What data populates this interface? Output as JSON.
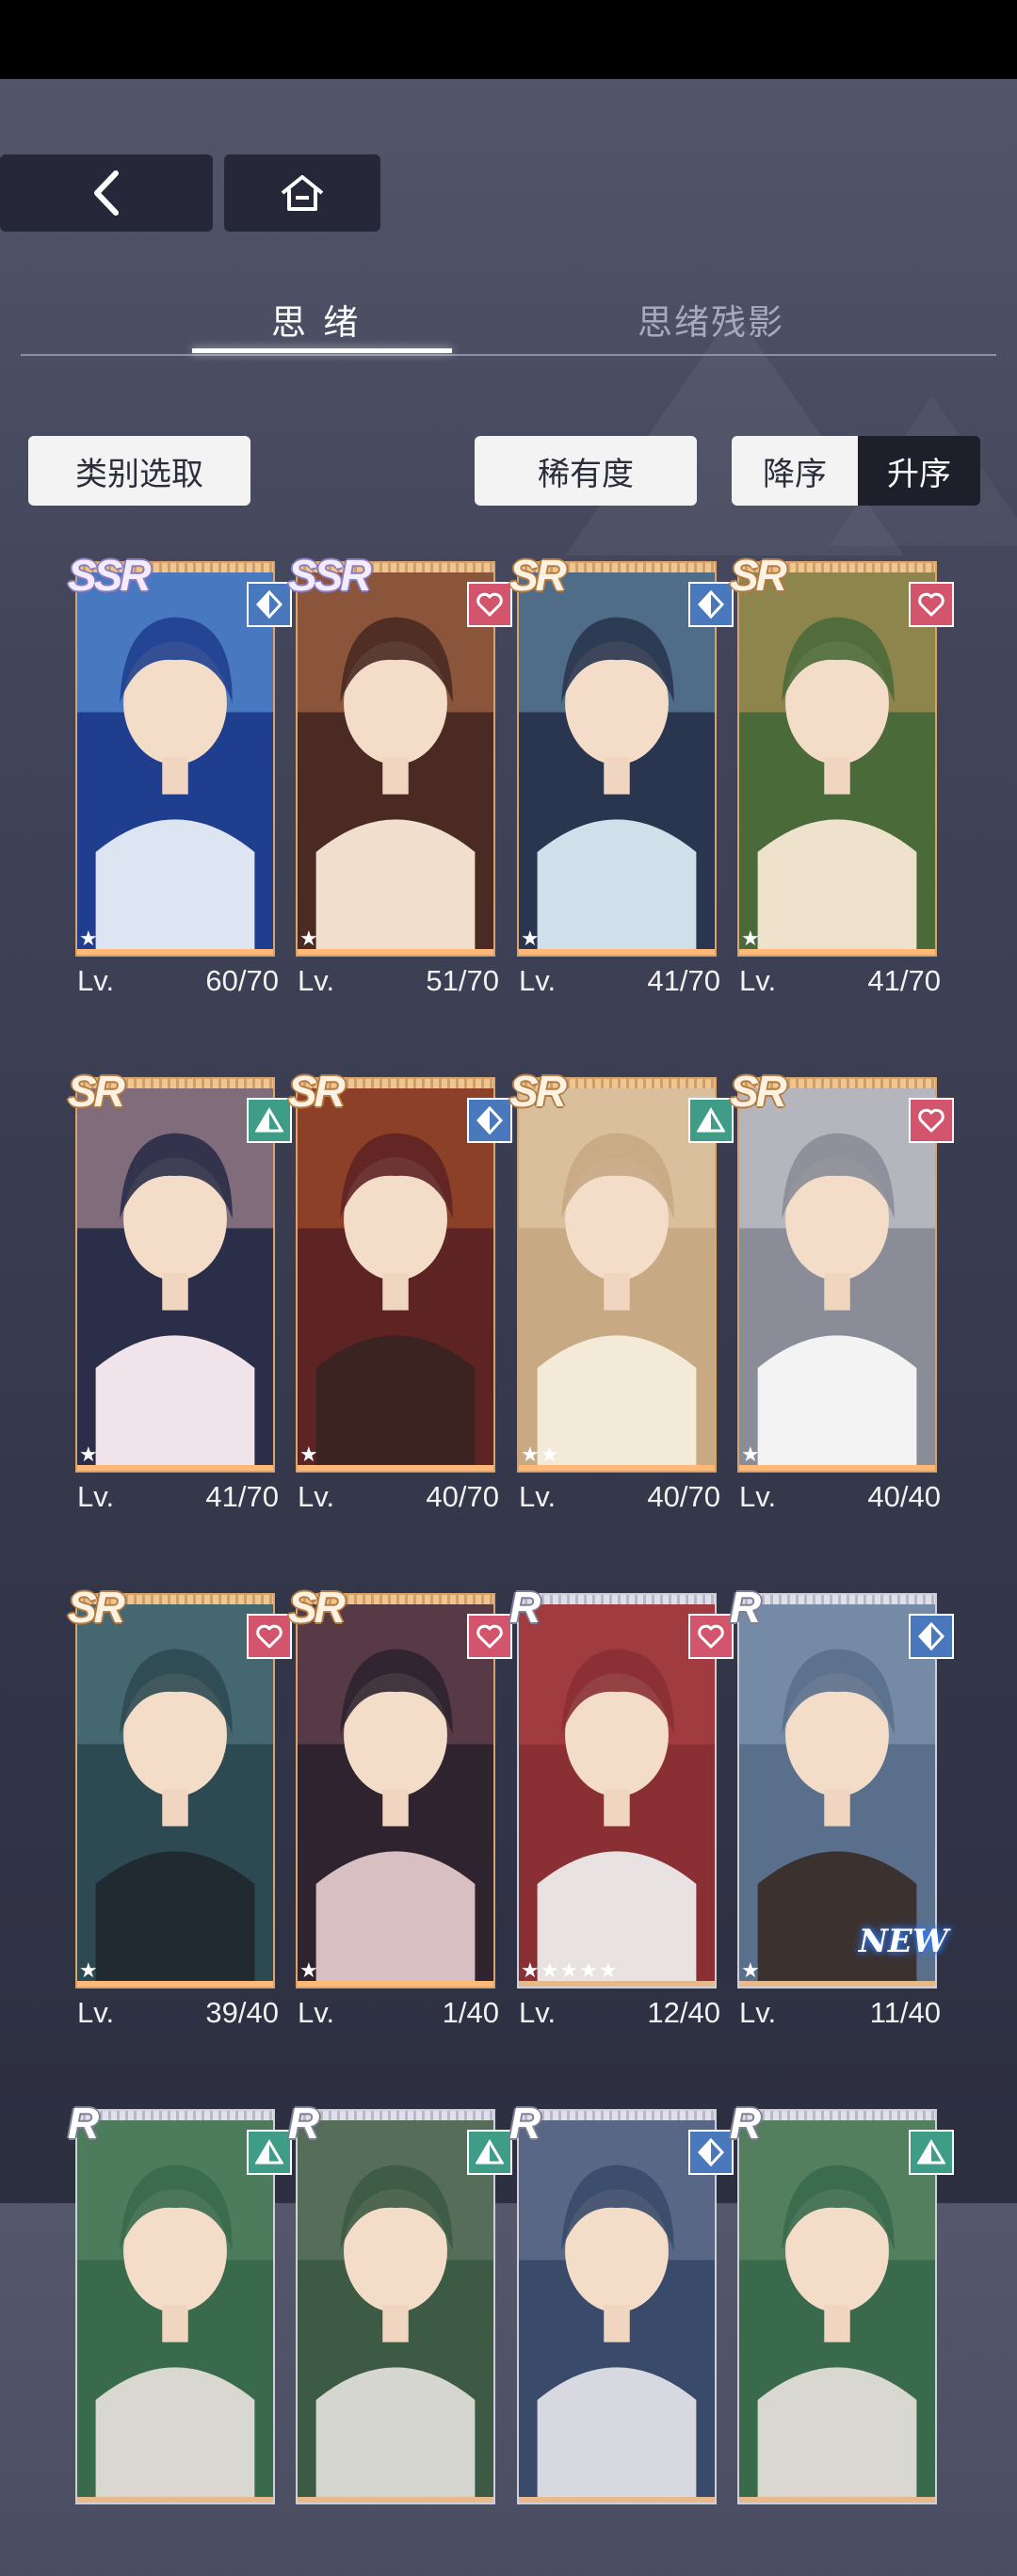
{
  "nav": {
    "back_icon": "chevron-left-icon",
    "home_icon": "home-icon"
  },
  "tabs": [
    {
      "label": "思 绪",
      "active": true
    },
    {
      "label": "思绪残影",
      "active": false
    }
  ],
  "filters": {
    "category_label": "类别选取",
    "rarity_label": "稀有度",
    "desc_label": "降序",
    "asc_label": "升序",
    "selected_order": "升序"
  },
  "colors": {
    "heart": "#d2556d",
    "diamond": "#4a78bd",
    "triangle": "#3f9c86",
    "frame_sr": "#d9a36a",
    "frame_r": "#cfcfda"
  },
  "cards": [
    {
      "rarity": "SSR",
      "attribute": "diamond",
      "stars": "★",
      "lv_label": "Lv.",
      "level": "60/70",
      "new_badge": ""
    },
    {
      "rarity": "SSR",
      "attribute": "heart",
      "stars": "★",
      "lv_label": "Lv.",
      "level": "51/70",
      "new_badge": ""
    },
    {
      "rarity": "SR",
      "attribute": "diamond",
      "stars": "★",
      "lv_label": "Lv.",
      "level": "41/70",
      "new_badge": ""
    },
    {
      "rarity": "SR",
      "attribute": "heart",
      "stars": "★",
      "lv_label": "Lv.",
      "level": "41/70",
      "new_badge": ""
    },
    {
      "rarity": "SR",
      "attribute": "triangle",
      "stars": "★",
      "lv_label": "Lv.",
      "level": "41/70",
      "new_badge": ""
    },
    {
      "rarity": "SR",
      "attribute": "diamond",
      "stars": "★",
      "lv_label": "Lv.",
      "level": "40/70",
      "new_badge": ""
    },
    {
      "rarity": "SR",
      "attribute": "triangle",
      "stars": "★★",
      "lv_label": "Lv.",
      "level": "40/70",
      "new_badge": ""
    },
    {
      "rarity": "SR",
      "attribute": "heart",
      "stars": "★",
      "lv_label": "Lv.",
      "level": "40/40",
      "new_badge": ""
    },
    {
      "rarity": "SR",
      "attribute": "heart",
      "stars": "★",
      "lv_label": "Lv.",
      "level": "39/40",
      "new_badge": ""
    },
    {
      "rarity": "SR",
      "attribute": "heart",
      "stars": "★",
      "lv_label": "Lv.",
      "level": "1/40",
      "new_badge": ""
    },
    {
      "rarity": "R",
      "attribute": "heart",
      "stars": "★★★★★",
      "lv_label": "Lv.",
      "level": "12/40",
      "new_badge": ""
    },
    {
      "rarity": "R",
      "attribute": "diamond",
      "stars": "★",
      "lv_label": "Lv.",
      "level": "11/40",
      "new_badge": "NEW"
    },
    {
      "rarity": "R",
      "attribute": "triangle",
      "stars": "",
      "lv_label": "",
      "level": "",
      "new_badge": ""
    },
    {
      "rarity": "R",
      "attribute": "triangle",
      "stars": "",
      "lv_label": "",
      "level": "",
      "new_badge": ""
    },
    {
      "rarity": "R",
      "attribute": "diamond",
      "stars": "",
      "lv_label": "",
      "level": "",
      "new_badge": ""
    },
    {
      "rarity": "R",
      "attribute": "triangle",
      "stars": "",
      "lv_label": "",
      "level": "",
      "new_badge": ""
    }
  ]
}
